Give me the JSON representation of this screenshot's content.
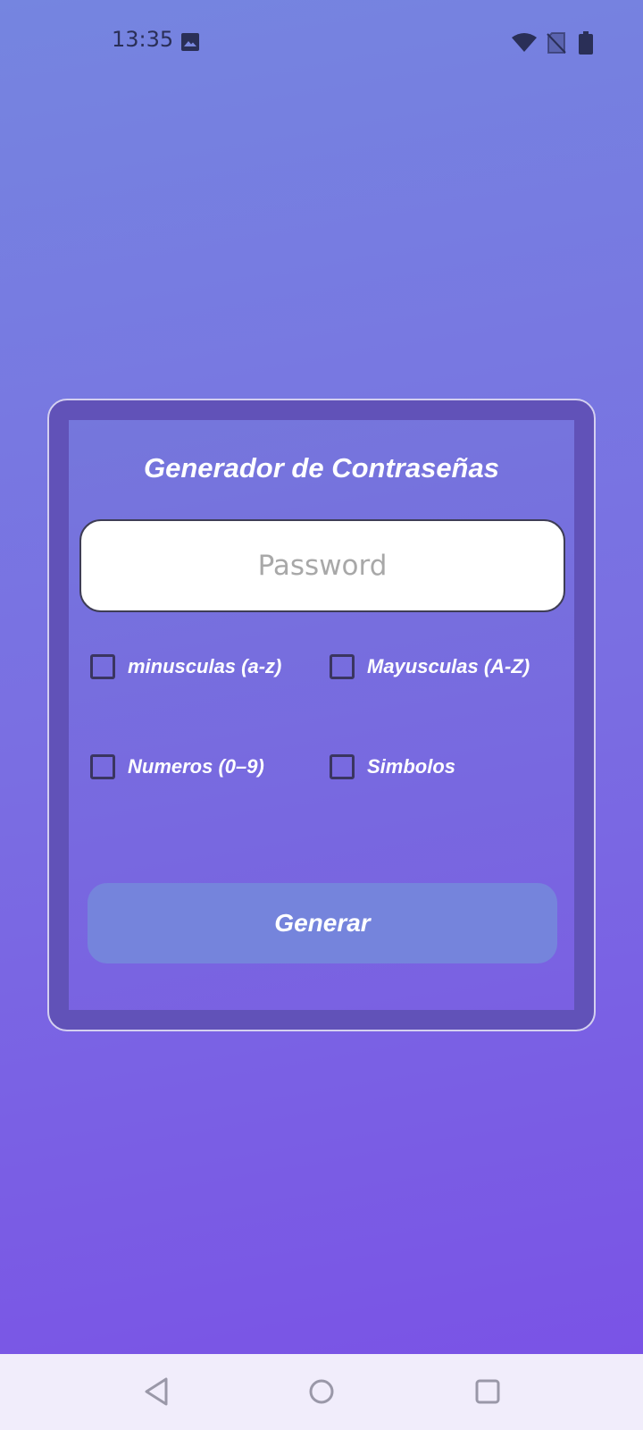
{
  "status_bar": {
    "time": "13:35",
    "icons": [
      "gallery-icon",
      "wifi-icon",
      "no-sim-icon",
      "battery-icon"
    ]
  },
  "card": {
    "title": "Generador de Contraseñas",
    "password_placeholder": "Password",
    "password_value": "",
    "options": [
      {
        "label": "minusculas (a-z)",
        "checked": false
      },
      {
        "label": "Mayusculas (A-Z)",
        "checked": false
      },
      {
        "label": "Numeros (0–9)",
        "checked": false
      },
      {
        "label": "Simbolos",
        "checked": false
      }
    ],
    "generate_label": "Generar"
  },
  "nav_bar": {
    "buttons": [
      "back-icon",
      "home-icon",
      "recents-icon"
    ]
  },
  "colors": {
    "gradient_top": "#7585e0",
    "gradient_bottom": "#7a50e6",
    "card_border": "#6152b8",
    "button": "#7584dc",
    "nav_bar": "#f1edfb"
  }
}
